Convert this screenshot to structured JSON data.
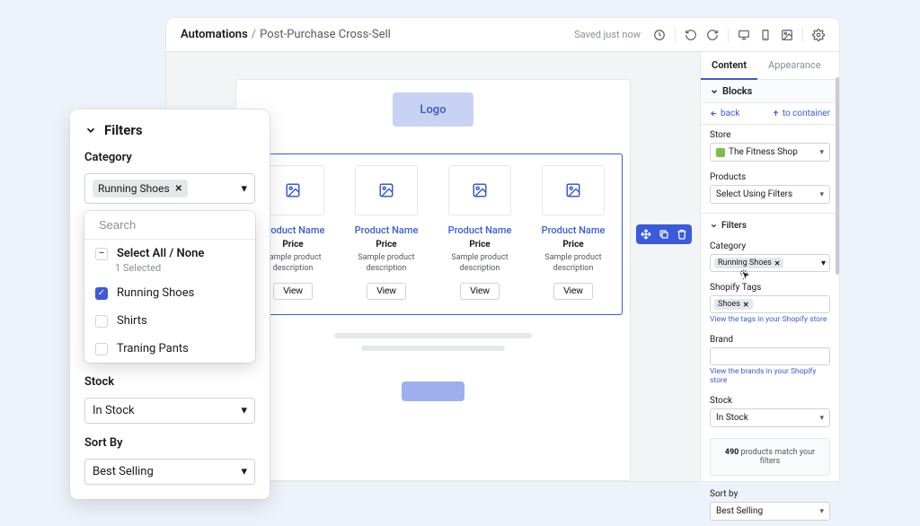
{
  "topbar": {
    "breadcrumb_root": "Automations",
    "breadcrumb_leaf": "Post-Purchase Cross-Sell",
    "saved_label": "Saved just now"
  },
  "canvas": {
    "logo_label": "Logo",
    "products": [
      {
        "name": "Product Name",
        "price": "Price",
        "desc": "Sample product description",
        "view": "View"
      },
      {
        "name": "Product Name",
        "price": "Price",
        "desc": "Sample product description",
        "view": "View"
      },
      {
        "name": "Product Name",
        "price": "Price",
        "desc": "Sample product description",
        "view": "View"
      },
      {
        "name": "Product Name",
        "price": "Price",
        "desc": "Sample product description",
        "view": "View"
      }
    ]
  },
  "right": {
    "tab_content": "Content",
    "tab_appearance": "Appearance",
    "blocks_label": "Blocks",
    "nav_back": "back",
    "nav_container": "to container",
    "store_label": "Store",
    "store_value": "The Fitness Shop",
    "products_label": "Products",
    "products_value": "Select Using Filters",
    "filters_label": "Filters",
    "category_label": "Category",
    "category_chip": "Running Shoes",
    "tags_label": "Shopify Tags",
    "tags_chip": "Shoes",
    "tags_help": "View the tags in your Shopify store",
    "brand_label": "Brand",
    "brand_help": "View the brands in your Shopify store",
    "stock_label": "Stock",
    "stock_value": "In Stock",
    "match_count": "490",
    "match_text": " products match your filters",
    "sortby_label": "Sort by",
    "sortby_value": "Best Selling"
  },
  "popover": {
    "title": "Filters",
    "category_label": "Category",
    "category_chip": "Running Shoes",
    "search_placeholder": "Search",
    "selectall_label": "Select All / None",
    "selected_count": "1 Selected",
    "options": [
      {
        "label": "Running Shoes",
        "checked": true
      },
      {
        "label": "Shirts",
        "checked": false
      },
      {
        "label": "Traning Pants",
        "checked": false
      }
    ],
    "stock_label": "Stock",
    "stock_value": "In Stock",
    "sortby_label": "Sort By",
    "sortby_value": "Best Selling"
  }
}
